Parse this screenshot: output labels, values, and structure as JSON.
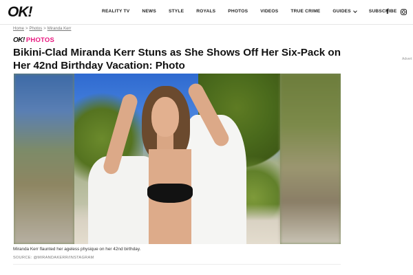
{
  "header": {
    "logo_text": "OK!",
    "nav": [
      {
        "label": "REALITY TV"
      },
      {
        "label": "NEWS"
      },
      {
        "label": "STYLE"
      },
      {
        "label": "ROYALS"
      },
      {
        "label": "PHOTOS"
      },
      {
        "label": "VIDEOS"
      },
      {
        "label": "TRUE CRIME"
      },
      {
        "label": "GUIDES"
      },
      {
        "label": "SUBSCRIBE"
      }
    ],
    "social": [
      {
        "icon": "facebook-icon",
        "glyph": "f"
      },
      {
        "icon": "instagram-icon"
      }
    ]
  },
  "breadcrumb": {
    "items": [
      "Home",
      "Photos",
      "Miranda Kerr"
    ],
    "separator": ">"
  },
  "kicker": {
    "logo_text": "OK!",
    "label": "PHOTOS",
    "color": "#e8177f"
  },
  "article": {
    "headline": "Bikini-Clad Miranda Kerr Stuns as She Shows Off Her Six-Pack on Her 42nd Birthday Vacation: Photo",
    "image_caption": "Miranda Kerr flaunted her ageless physique on her 42nd birthday.",
    "image_source": "SOURCE: @MIRANDAKERR/INSTAGRAM"
  },
  "ad": {
    "label": "Advert"
  }
}
